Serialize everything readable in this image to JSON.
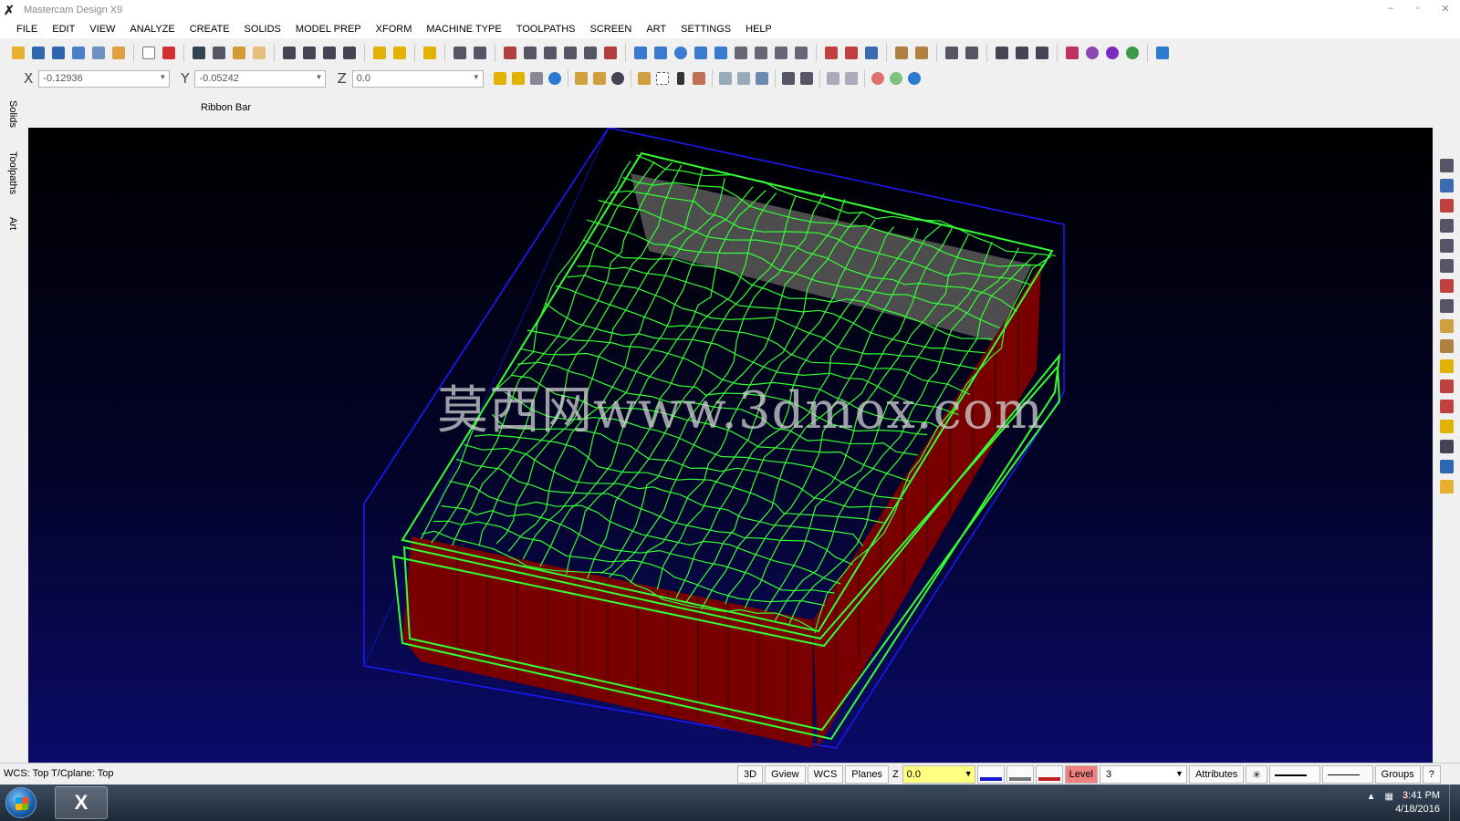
{
  "window": {
    "title": "Mastercam Design X9",
    "controls": [
      "–",
      "▫",
      "✕"
    ]
  },
  "menu": [
    "FILE",
    "EDIT",
    "VIEW",
    "ANALYZE",
    "CREATE",
    "SOLIDS",
    "MODEL PREP",
    "XFORM",
    "MACHINE TYPE",
    "TOOLPATHS",
    "SCREEN",
    "ART",
    "SETTINGS",
    "HELP"
  ],
  "coords": {
    "x_label": "X",
    "x_value": "-0.12936",
    "y_label": "Y",
    "y_value": "-0.05242",
    "z_label": "Z",
    "z_value": "0.0"
  },
  "ribbon_label": "Ribbon Bar",
  "side_tabs": [
    "Solids",
    "Toolpaths",
    "Art"
  ],
  "viewport": {
    "watermark": "莫西网www.3dmox.com",
    "colors": {
      "wireframe": "#33ff33",
      "bounding_box": "#1a1aff",
      "wall": "#7a0000",
      "floor": "#555555"
    }
  },
  "status": {
    "text": "WCS: Top  T/Cplane: Top",
    "buttons": [
      "3D",
      "Gview",
      "WCS",
      "Planes"
    ],
    "z_label": "Z",
    "z_value": "0.0",
    "level_label": "Level",
    "level_value": "3",
    "attributes": "Attributes",
    "point_style": "✳",
    "groups": "Groups",
    "help": "?"
  },
  "taskbar": {
    "app_icon": "X",
    "time": "3:41 PM",
    "date": "4/18/2016"
  }
}
